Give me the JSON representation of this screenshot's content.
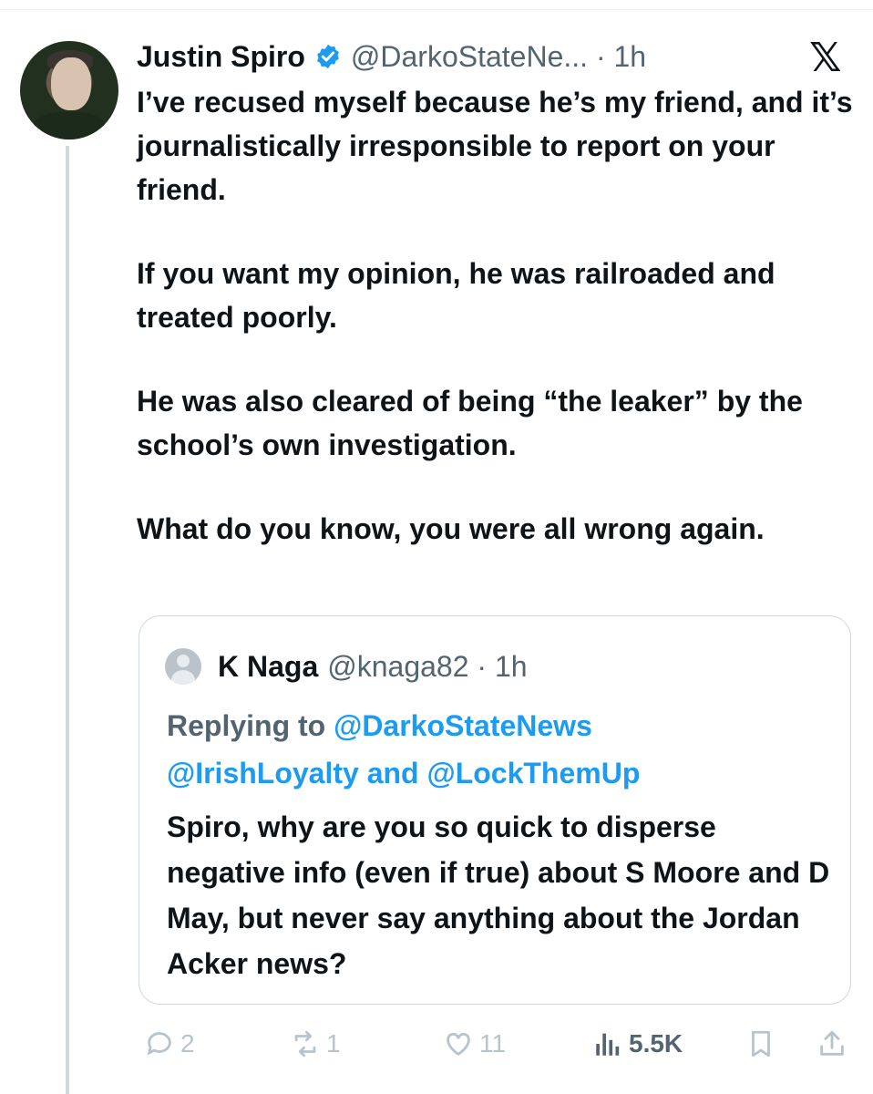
{
  "tweet": {
    "author_name": "Justin Spiro",
    "handle_time": "@DarkoStateNe... · 1h",
    "paragraphs": [
      "I’ve recused myself because he’s my friend, and it’s journalistically irresponsible to report on your friend.",
      "If you want my opinion, he was railroaded and treated poorly.",
      "He was also cleared of being “the leaker” by the school’s own investigation.",
      "What do you know, you were all wrong again."
    ]
  },
  "quoted": {
    "author_name": "K Naga",
    "handle_time": "@knaga82 · 1h",
    "replying_prefix": "Replying to",
    "mention_1": "@DarkoStateNews",
    "mention_2": "@IrishLoyalty",
    "conjunction": "and",
    "mention_3": "@LockThemUp",
    "text": "Spiro, why are you so quick to disperse negative info (even if true) about S Moore and D May, but never say anything about the Jordan Acker news?"
  },
  "actions": {
    "replies": "2",
    "reposts": "1",
    "likes": "11",
    "views": "5.5K"
  },
  "icons": [
    "verified-badge-icon",
    "x-logo-icon",
    "reply-icon",
    "repost-icon",
    "like-icon",
    "views-icon",
    "bookmark-icon",
    "share-icon"
  ],
  "colors": {
    "accent": "#1d9bf0",
    "muted": "#536471",
    "faint": "#b8c4cb"
  }
}
